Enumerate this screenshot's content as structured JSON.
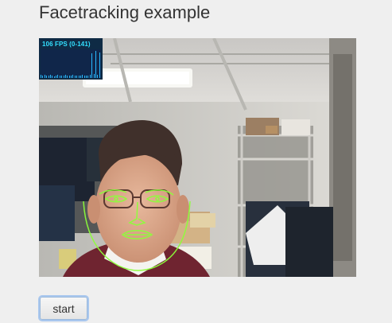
{
  "page": {
    "title": "Facetracking example"
  },
  "video": {
    "fps_text": "106 FPS (0-141)",
    "fps_graph_values": [
      0.1,
      0.08,
      0.12,
      0.09,
      0.07,
      0.11,
      0.08,
      0.06,
      0.09,
      0.1,
      0.08,
      0.07,
      0.09,
      0.11,
      0.08,
      0.07,
      0.09,
      0.1,
      0.08,
      0.09,
      0.07,
      0.08,
      0.1,
      0.08,
      0.09,
      0.07,
      0.12,
      0.85,
      0.15,
      0.95,
      0.1,
      0.88
    ]
  },
  "controls": {
    "start_label": "start"
  },
  "colors": {
    "tracker_lines": "#8cff3a",
    "fps_text": "#33e0ff",
    "fps_bg": "#0f2b45",
    "button_focus": "#a9c7ee"
  }
}
